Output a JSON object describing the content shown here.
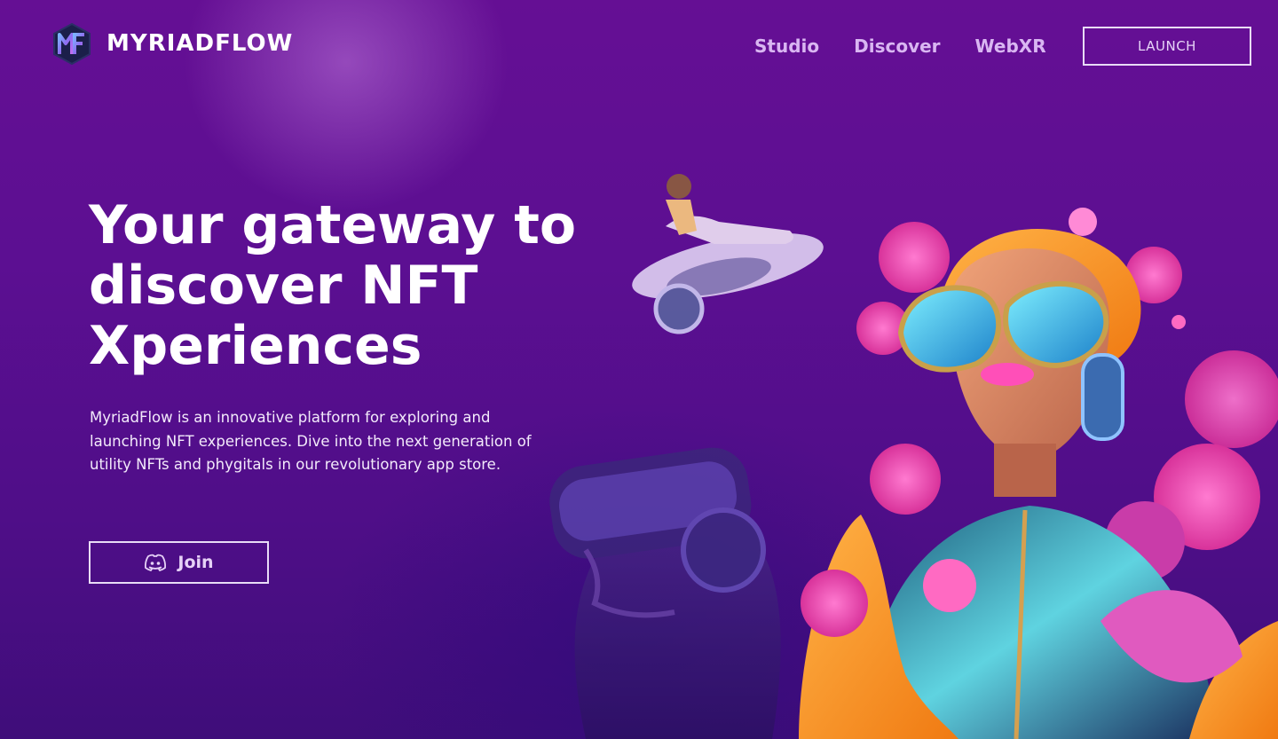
{
  "header": {
    "brand": "MYRIADFLOW",
    "logo_icon": "myriadflow-logo-icon",
    "nav": [
      {
        "label": "Studio"
      },
      {
        "label": "Discover"
      },
      {
        "label": "WebXR"
      }
    ],
    "launch_label": "LAUNCH"
  },
  "hero": {
    "title_lines": [
      "Your gateway to",
      "discover NFT",
      "Xperiences"
    ],
    "description": "MyriadFlow is an innovative platform for exploring and launching NFT experiences. Dive into the next generation of utility NFTs and phygitals in our revolutionary app store.",
    "join_label": "Join",
    "join_icon": "discord-icon"
  },
  "colors": {
    "background": "#5c0f92",
    "nav_text": "#d9b6f2",
    "button_border": "#e9dcf7"
  }
}
